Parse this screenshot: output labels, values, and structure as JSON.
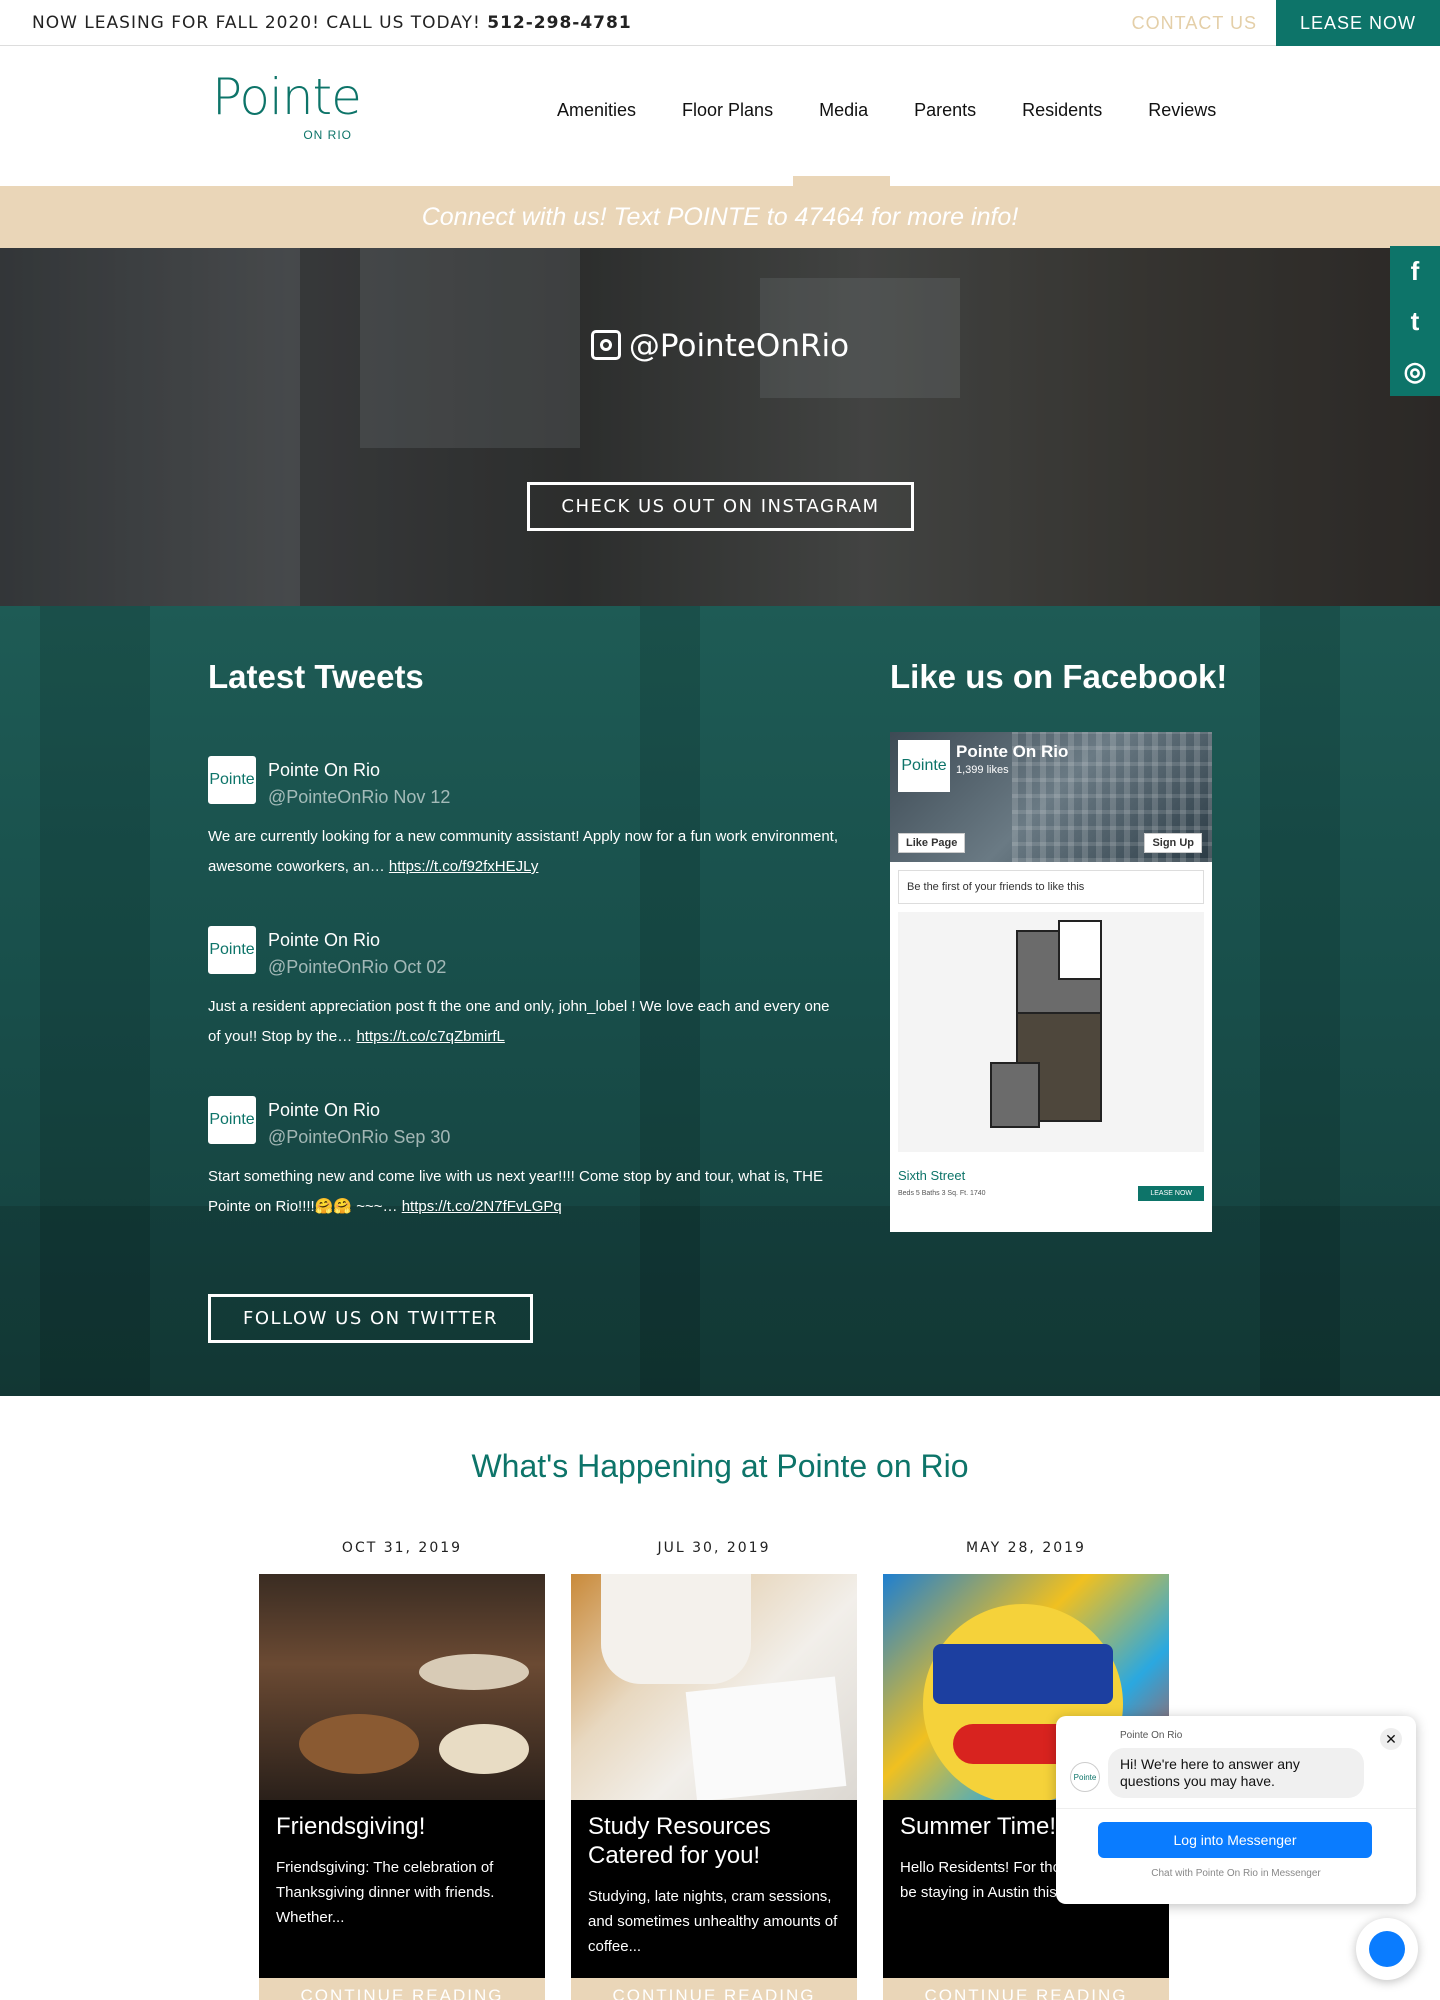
{
  "topbar": {
    "leasing_text": "NOW LEASING FOR FALL 2020! CALL US TODAY!",
    "phone": "512-298-4781",
    "contact_label": "CONTACT US",
    "lease_label": "LEASE NOW"
  },
  "logo": {
    "word": "Pointe",
    "sub": "ON RIO"
  },
  "nav": [
    "Amenities",
    "Floor Plans",
    "Media",
    "Parents",
    "Residents",
    "Reviews"
  ],
  "promo": "Connect with us! Text POINTE to 47464 for more info!",
  "instagram": {
    "handle": "@PointeOnRio",
    "button": "CHECK US OUT ON INSTAGRAM"
  },
  "social_tabs": {
    "facebook": "f",
    "twitter": "t",
    "instagram": "◎"
  },
  "tweets": {
    "heading": "Latest Tweets",
    "items": [
      {
        "name": "Pointe On Rio",
        "handle": "@PointeOnRio Nov 12",
        "text": "We are currently looking for a new community assistant! Apply now for a fun work environment, awesome coworkers, an…",
        "link": "https://t.co/f92fxHEJLy"
      },
      {
        "name": "Pointe On Rio",
        "handle": "@PointeOnRio Oct 02",
        "text": "Just a resident appreciation post ft the one and only, john_lobel ! We love each and every one of you!! Stop by the…",
        "link": "https://t.co/c7qZbmirfL"
      },
      {
        "name": "Pointe On Rio",
        "handle": "@PointeOnRio Sep 30",
        "text": "Start something new and come live with us next year!!!! Come stop by and tour, what is, THE Pointe on Rio!!!!🤗🤗 ~~~…",
        "link": "https://t.co/2N7fFvLGPq"
      }
    ],
    "follow_button": "FOLLOW US ON TWITTER",
    "avatar_text": "Pointe"
  },
  "facebook": {
    "heading": "Like us on Facebook!",
    "page_name": "Pointe On Rio",
    "likes": "1,399 likes",
    "like_button": "Like Page",
    "signup_button": "Sign Up",
    "friends_text": "Be the first of your friends to like this",
    "plan_name": "Sixth Street",
    "specs": "Beds 5     Baths 3     Sq. Ft. 1740",
    "lease_now": "LEASE NOW"
  },
  "happening": {
    "title": "What's Happening at Pointe on Rio",
    "posts": [
      {
        "date": "OCT 31, 2019",
        "title": "Friendsgiving!",
        "excerpt": "Friendsgiving: The celebration of Thanksgiving dinner with friends. Whether...",
        "more": "CONTINUE READING"
      },
      {
        "date": "JUL 30, 2019",
        "title": "Study Resources Catered for you!",
        "excerpt": "Studying, late nights, cram sessions, and sometimes unhealthy amounts of coffee...",
        "more": "CONTINUE READING"
      },
      {
        "date": "MAY 28, 2019",
        "title": "Summer Time!",
        "excerpt": "Hello Residents!  For those who will be staying in Austin this Summer....",
        "more": "CONTINUE READING"
      }
    ]
  },
  "messenger": {
    "page_name": "Pointe On Rio",
    "greeting": "Hi! We're here to answer any questions you may have.",
    "login_button": "Log into Messenger",
    "note": "Chat with Pointe On Rio in Messenger",
    "close": "✕"
  },
  "colors": {
    "brand": "#0d7469",
    "tan": "#ead6b8",
    "messenger": "#0a7cff"
  }
}
